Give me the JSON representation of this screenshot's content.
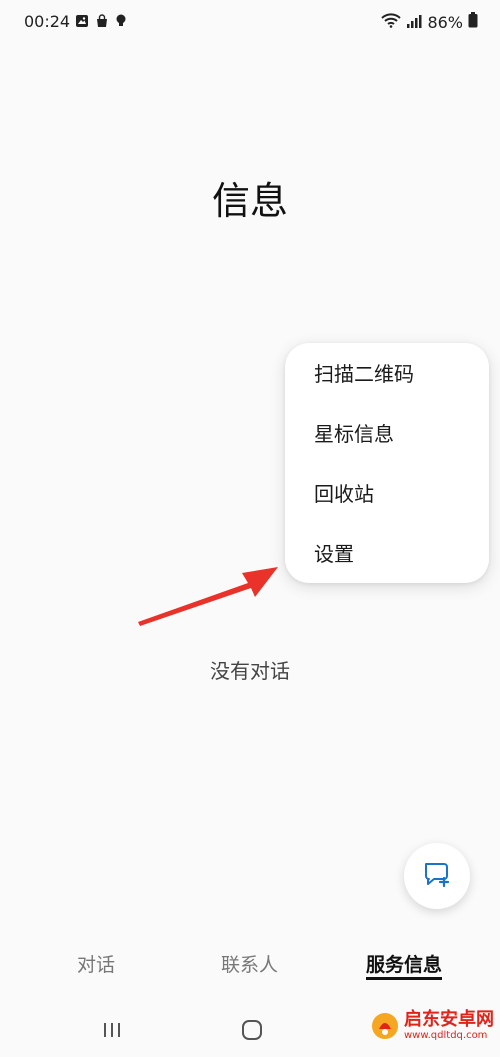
{
  "status_bar": {
    "time": "00:24",
    "battery": "86%",
    "icons": [
      "image-icon",
      "bag-icon",
      "bulb-icon",
      "wifi-icon",
      "signal-icon",
      "battery-icon"
    ]
  },
  "header": {
    "title": "信息"
  },
  "overflow_menu": {
    "items": [
      {
        "label": "扫描二维码"
      },
      {
        "label": "星标信息"
      },
      {
        "label": "回收站"
      },
      {
        "label": "设置"
      }
    ]
  },
  "main": {
    "empty_text": "没有对话"
  },
  "fab": {
    "icon": "new-message-icon",
    "accent": "#1a73c8"
  },
  "bottom_tabs": [
    {
      "label": "对话",
      "active": false
    },
    {
      "label": "联系人",
      "active": false
    },
    {
      "label": "服务信息",
      "active": true
    }
  ],
  "watermark": {
    "title": "启东安卓网",
    "url": "www.qdltdq.com",
    "color": "#e2231a"
  },
  "annotation": {
    "arrow_color": "#e8322a"
  }
}
